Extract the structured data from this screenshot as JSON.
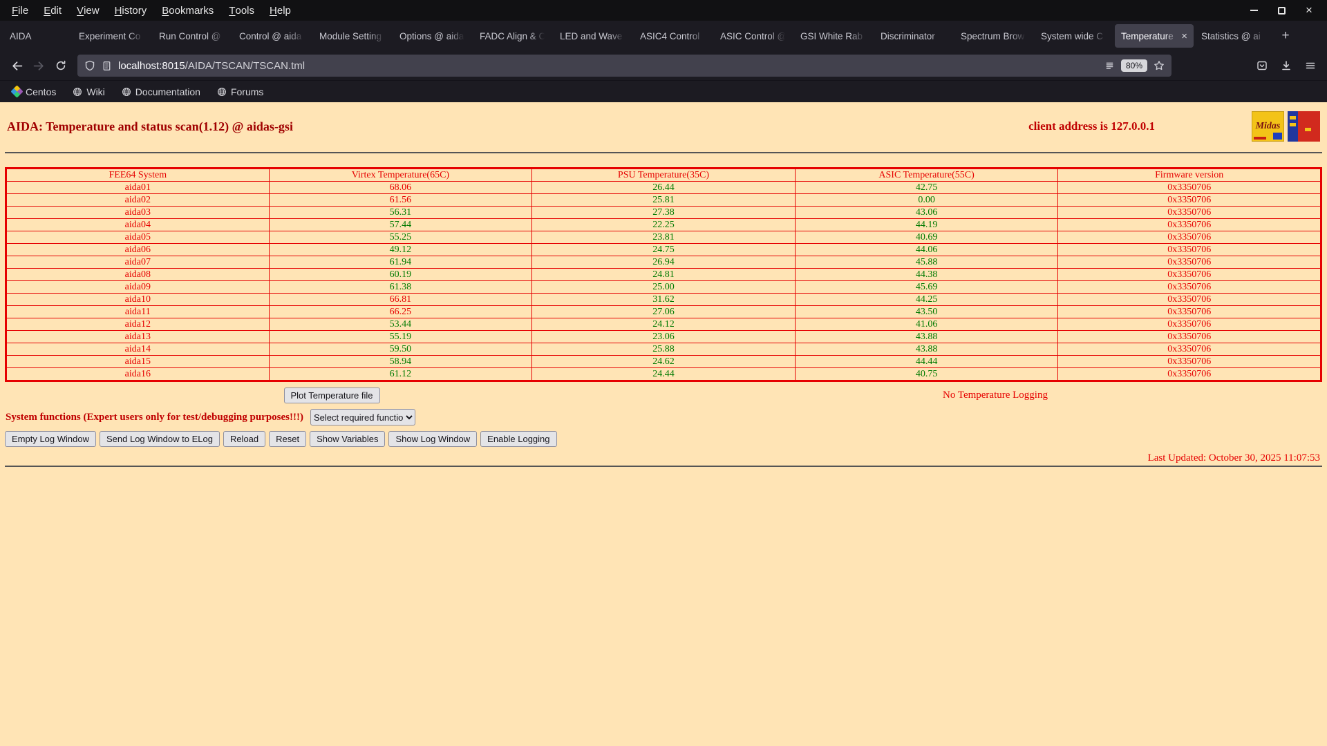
{
  "colors": {
    "page_background": "#ffe4b5",
    "alarm_red": "#e60000",
    "ok_green": "#007a00",
    "title_red": "#a00000"
  },
  "icons": {
    "back": "left-arrow",
    "forward": "right-arrow",
    "reload": "circular-arrow",
    "shield": "shield-outline",
    "page_info": "document-outline",
    "reader": "text-lines",
    "bookmark_star": "star-outline",
    "extension": "box-with-chevron",
    "downloads": "down-arrow-tray",
    "menu": "hamburger",
    "globe": "globe-outline",
    "centos": "four-color-pinwheel",
    "close": "×",
    "new_tab": "+"
  },
  "browser": {
    "menu": [
      "File",
      "Edit",
      "View",
      "History",
      "Bookmarks",
      "Tools",
      "Help"
    ],
    "tabs": [
      {
        "label": "AIDA",
        "active": false
      },
      {
        "label": "Experiment Co",
        "active": false
      },
      {
        "label": "Run Control @",
        "active": false
      },
      {
        "label": "Control @ aida",
        "active": false
      },
      {
        "label": "Module Setting",
        "active": false
      },
      {
        "label": "Options @ aida",
        "active": false
      },
      {
        "label": "FADC Align & C",
        "active": false
      },
      {
        "label": "LED and Wave",
        "active": false
      },
      {
        "label": "ASIC4 Control",
        "active": false
      },
      {
        "label": "ASIC Control @",
        "active": false
      },
      {
        "label": "GSI White Rab",
        "active": false
      },
      {
        "label": "Discriminator",
        "active": false
      },
      {
        "label": "Spectrum Brow",
        "active": false
      },
      {
        "label": "System wide C",
        "active": false
      },
      {
        "label": "Temperature",
        "active": true
      },
      {
        "label": "Statistics @ ai",
        "active": false
      }
    ],
    "nav": {
      "url_host": "localhost:8015",
      "url_path": "/AIDA/TSCAN/TSCAN.tml",
      "zoom": "80%"
    },
    "bookmarks": [
      "Centos",
      "Wiki",
      "Documentation",
      "Forums"
    ]
  },
  "page": {
    "title": "AIDA: Temperature and status scan(1.12) @ aidas-gsi",
    "client_address": "client address is 127.0.0.1",
    "logo_midas_text": "Midas",
    "table": {
      "headers": [
        "FEE64 System",
        "Virtex Temperature(65C)",
        "PSU Temperature(35C)",
        "ASIC Temperature(55C)",
        "Firmware version"
      ],
      "rows": [
        {
          "name": "aida01",
          "virtex": "68.06",
          "virtex_alarm": true,
          "psu": "26.44",
          "asic": "42.75",
          "firmware": "0x3350706"
        },
        {
          "name": "aida02",
          "virtex": "61.56",
          "virtex_alarm": true,
          "psu": "25.81",
          "asic": "0.00",
          "firmware": "0x3350706"
        },
        {
          "name": "aida03",
          "virtex": "56.31",
          "virtex_alarm": false,
          "psu": "27.38",
          "asic": "43.06",
          "firmware": "0x3350706"
        },
        {
          "name": "aida04",
          "virtex": "57.44",
          "virtex_alarm": false,
          "psu": "22.25",
          "asic": "44.19",
          "firmware": "0x3350706"
        },
        {
          "name": "aida05",
          "virtex": "55.25",
          "virtex_alarm": false,
          "psu": "23.81",
          "asic": "40.69",
          "firmware": "0x3350706"
        },
        {
          "name": "aida06",
          "virtex": "49.12",
          "virtex_alarm": false,
          "psu": "24.75",
          "asic": "44.06",
          "firmware": "0x3350706"
        },
        {
          "name": "aida07",
          "virtex": "61.94",
          "virtex_alarm": false,
          "psu": "26.94",
          "asic": "45.88",
          "firmware": "0x3350706"
        },
        {
          "name": "aida08",
          "virtex": "60.19",
          "virtex_alarm": false,
          "psu": "24.81",
          "asic": "44.38",
          "firmware": "0x3350706"
        },
        {
          "name": "aida09",
          "virtex": "61.38",
          "virtex_alarm": false,
          "psu": "25.00",
          "asic": "45.69",
          "firmware": "0x3350706"
        },
        {
          "name": "aida10",
          "virtex": "66.81",
          "virtex_alarm": true,
          "psu": "31.62",
          "asic": "44.25",
          "firmware": "0x3350706"
        },
        {
          "name": "aida11",
          "virtex": "66.25",
          "virtex_alarm": true,
          "psu": "27.06",
          "asic": "43.50",
          "firmware": "0x3350706"
        },
        {
          "name": "aida12",
          "virtex": "53.44",
          "virtex_alarm": false,
          "psu": "24.12",
          "asic": "41.06",
          "firmware": "0x3350706"
        },
        {
          "name": "aida13",
          "virtex": "55.19",
          "virtex_alarm": false,
          "psu": "23.06",
          "asic": "43.88",
          "firmware": "0x3350706"
        },
        {
          "name": "aida14",
          "virtex": "59.50",
          "virtex_alarm": false,
          "psu": "25.88",
          "asic": "43.88",
          "firmware": "0x3350706"
        },
        {
          "name": "aida15",
          "virtex": "58.94",
          "virtex_alarm": false,
          "psu": "24.62",
          "asic": "44.44",
          "firmware": "0x3350706"
        },
        {
          "name": "aida16",
          "virtex": "61.12",
          "virtex_alarm": false,
          "psu": "24.44",
          "asic": "40.75",
          "firmware": "0x3350706"
        }
      ]
    },
    "plot_button_label": "Plot Temperature file",
    "logging_status": "No Temperature Logging",
    "system_functions_label": "System functions (Expert users only for test/debugging purposes!!!)",
    "select_option": "Select required function",
    "action_buttons": [
      "Empty Log Window",
      "Send Log Window to ELog",
      "Reload",
      "Reset",
      "Show Variables",
      "Show Log Window",
      "Enable Logging"
    ],
    "last_updated": "Last Updated: October 30, 2025 11:07:53"
  }
}
